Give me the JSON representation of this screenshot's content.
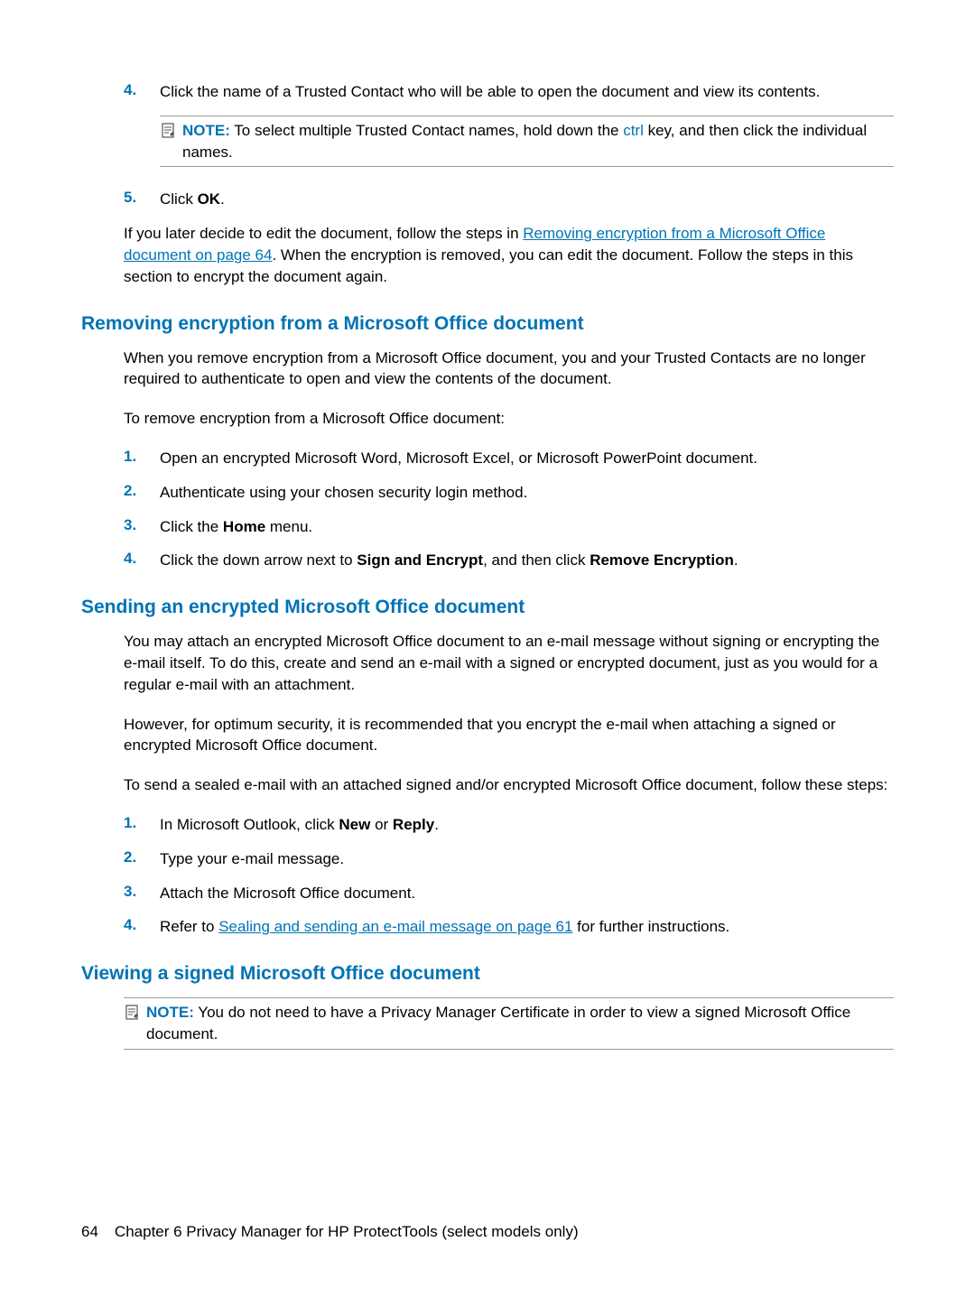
{
  "step4": {
    "num": "4.",
    "text": "Click the name of a Trusted Contact who will be able to open the document and view its contents."
  },
  "note1": {
    "label": "NOTE:",
    "before_key": "   To select multiple Trusted Contact names, hold down the ",
    "key": "ctrl",
    "after_key": " key, and then click the individual names."
  },
  "step5": {
    "num": "5.",
    "before_bold": "Click ",
    "bold": "OK",
    "after_bold": "."
  },
  "para1": {
    "before_link": "If you later decide to edit the document, follow the steps in ",
    "link": "Removing encryption from a Microsoft Office document on page 64",
    "after_link": ". When the encryption is removed, you can edit the document. Follow the steps in this section to encrypt the document again."
  },
  "h2_removing": "Removing encryption from a Microsoft Office document",
  "para_removing1": "When you remove encryption from a Microsoft Office document, you and your Trusted Contacts are no longer required to authenticate to open and view the contents of the document.",
  "para_removing2": "To remove encryption from a Microsoft Office document:",
  "rem_step1": {
    "num": "1.",
    "text": "Open an encrypted Microsoft Word, Microsoft Excel, or Microsoft PowerPoint document."
  },
  "rem_step2": {
    "num": "2.",
    "text": "Authenticate using your chosen security login method."
  },
  "rem_step3": {
    "num": "3.",
    "before_bold": "Click the ",
    "bold": "Home",
    "after_bold": " menu."
  },
  "rem_step4": {
    "num": "4.",
    "before_bold1": "Click the down arrow next to ",
    "bold1": "Sign and Encrypt",
    "mid": ", and then click ",
    "bold2": "Remove Encryption",
    "after": "."
  },
  "h2_sending": "Sending an encrypted Microsoft Office document",
  "para_sending1": "You may attach an encrypted Microsoft Office document to an e-mail message without signing or encrypting the e-mail itself. To do this, create and send an e-mail with a signed or encrypted document, just as you would for a regular e-mail with an attachment.",
  "para_sending2": "However, for optimum security, it is recommended that you encrypt the e-mail when attaching a signed or encrypted Microsoft Office document.",
  "para_sending3": "To send a sealed e-mail with an attached signed and/or encrypted Microsoft Office document, follow these steps:",
  "send_step1": {
    "num": "1.",
    "before_bold1": "In Microsoft Outlook, click ",
    "bold1": "New",
    "mid": " or ",
    "bold2": "Reply",
    "after": "."
  },
  "send_step2": {
    "num": "2.",
    "text": "Type your e-mail message."
  },
  "send_step3": {
    "num": "3.",
    "text": "Attach the Microsoft Office document."
  },
  "send_step4": {
    "num": "4.",
    "before_link": "Refer to ",
    "link": "Sealing and sending an e-mail message on page 61",
    "after_link": " for further instructions."
  },
  "h2_viewing": "Viewing a signed Microsoft Office document",
  "note2": {
    "label": "NOTE:",
    "text": "   You do not need to have a Privacy Manager Certificate in order to view a signed Microsoft Office document."
  },
  "footer": {
    "page": "64",
    "chapter": "Chapter 6   Privacy Manager for HP ProtectTools (select models only)"
  }
}
